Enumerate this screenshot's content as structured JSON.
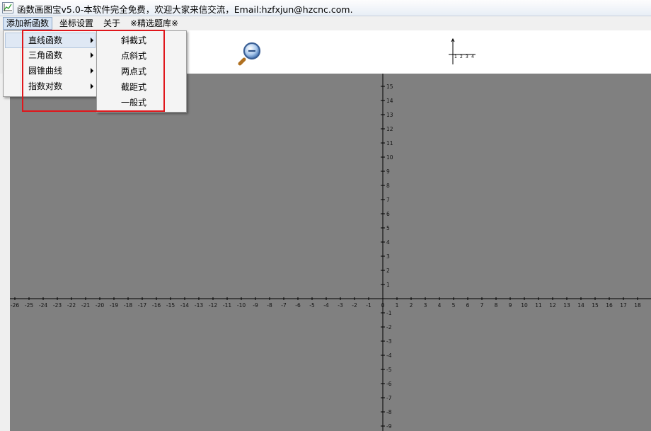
{
  "window": {
    "title": "函数画图宝v5.0-本软件完全免费，欢迎大家来信交流，Email:hzfxjun@hzcnc.com.",
    "app_icon": "chart-app-icon"
  },
  "menubar": {
    "items": [
      "添加新函数",
      "坐标设置",
      "关于",
      "※精选题库※"
    ],
    "active_index": 0
  },
  "toolbar": {
    "zoom_icon": "magnifier-icon",
    "axes_icon": "axes-icon"
  },
  "dropdown": {
    "items": [
      {
        "label": "直线函数"
      },
      {
        "label": "三角函数"
      },
      {
        "label": "圆锥曲线"
      },
      {
        "label": "指数对数"
      }
    ],
    "selected_index": 0
  },
  "submenu": {
    "items": [
      "斜截式",
      "点斜式",
      "两点式",
      "截距式",
      "一般式"
    ]
  },
  "graph": {
    "x_ticks": [
      "-26",
      "-25",
      "-24",
      "-23",
      "-22",
      "-21",
      "-20",
      "-19",
      "-18",
      "-17",
      "-16",
      "-15",
      "-14",
      "-13",
      "-12",
      "-11",
      "-10",
      "-9",
      "-8",
      "-7",
      "-6",
      "-5",
      "-4",
      "-3",
      "-2",
      "-1",
      "0",
      "1",
      "2",
      "3",
      "4",
      "5",
      "6",
      "7",
      "8",
      "9",
      "10",
      "11",
      "12",
      "13",
      "14",
      "15",
      "16",
      "17",
      "18"
    ],
    "y_ticks": [
      "15",
      "14",
      "13",
      "12",
      "11",
      "10",
      "9",
      "8",
      "7",
      "6",
      "5",
      "4",
      "3",
      "2",
      "1",
      "-1",
      "-2",
      "-3",
      "-4",
      "-5",
      "-6",
      "-7",
      "-8",
      "-9"
    ],
    "colors": {
      "background": "#808080",
      "axis": "#000000"
    }
  }
}
